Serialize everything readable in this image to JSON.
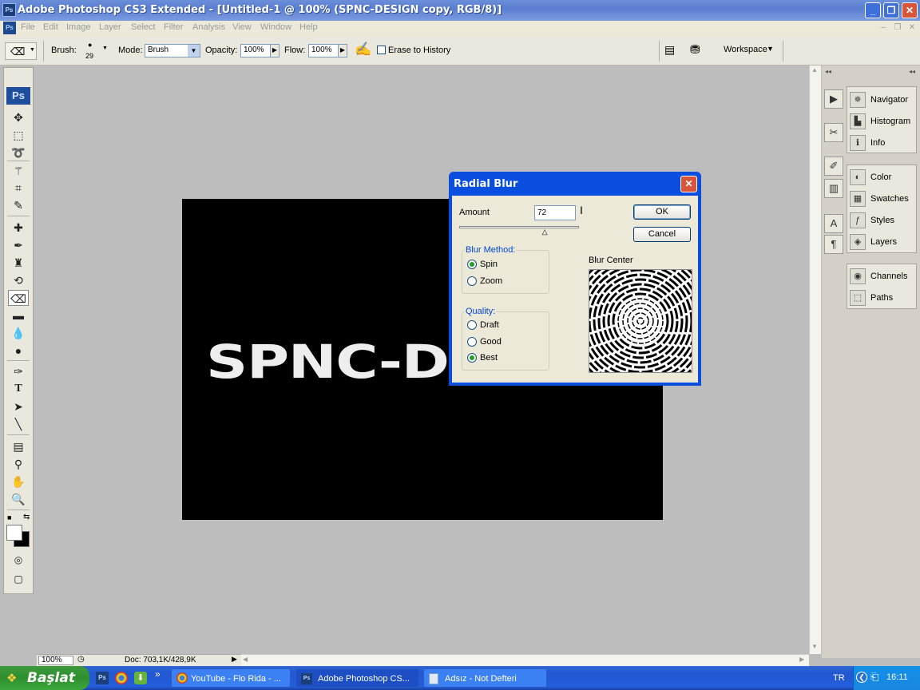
{
  "window": {
    "app_icon": "Ps",
    "title": "Adobe Photoshop CS3 Extended - [Untitled-1 @ 100% (SPNC-DESIGN copy, RGB/8)]",
    "controls": {
      "minimize": "_",
      "maximize": "❐",
      "close": "✕"
    }
  },
  "menubar": {
    "items": [
      "File",
      "Edit",
      "Image",
      "Layer",
      "Select",
      "Filter",
      "Analysis",
      "View",
      "Window",
      "Help"
    ],
    "mdi_controls": [
      "–",
      "❐",
      "✕"
    ]
  },
  "options": {
    "brush_label": "Brush:",
    "brush_size": "29",
    "mode_label": "Mode:",
    "mode_value": "Brush",
    "opacity_label": "Opacity:",
    "opacity_value": "100%",
    "flow_label": "Flow:",
    "flow_value": "100%",
    "erase_history_label": "Erase to History",
    "erase_history_checked": false,
    "workspace_label": "Workspace"
  },
  "tools": {
    "logo": "Ps",
    "items": [
      "move-icon",
      "marquee-icon",
      "lasso-icon",
      "magic-wand-icon",
      "crop-icon",
      "slice-icon",
      "healing-brush-icon",
      "brush-icon",
      "clone-stamp-icon",
      "history-brush-icon",
      "eraser-icon",
      "gradient-icon",
      "blur-icon",
      "dodge-icon",
      "pen-icon",
      "type-icon",
      "path-selection-icon",
      "line-icon",
      "notes-icon",
      "eyedropper-icon",
      "hand-icon",
      "zoom-icon"
    ],
    "active": "eraser-icon",
    "type_glyph": "T"
  },
  "canvas": {
    "text": "SPNC-D",
    "background": "#000000",
    "text_color": "#eeeeee"
  },
  "status": {
    "zoom": "100%",
    "doc": "Doc: 703,1K/428,9K"
  },
  "panels": {
    "group1": [
      "Navigator",
      "Histogram",
      "Info"
    ],
    "group2": [
      "Color",
      "Swatches",
      "Styles",
      "Layers"
    ],
    "group3": [
      "Channels",
      "Paths"
    ],
    "icons1": [
      "navigator-icon",
      "histogram-icon",
      "info-icon"
    ],
    "icons2": [
      "color-icon",
      "swatches-icon",
      "styles-icon",
      "layers-icon"
    ],
    "icons3": [
      "channels-icon",
      "paths-icon"
    ]
  },
  "dialog": {
    "title": "Radial Blur",
    "amount_label": "Amount",
    "amount_value": "72",
    "amount_range": [
      1,
      100
    ],
    "ok_label": "OK",
    "cancel_label": "Cancel",
    "blur_method_label": "Blur Method:",
    "method_options": [
      "Spin",
      "Zoom"
    ],
    "method_selected": "Spin",
    "quality_label": "Quality:",
    "quality_options": [
      "Draft",
      "Good",
      "Best"
    ],
    "quality_selected": "Best",
    "blur_center_label": "Blur Center"
  },
  "taskbar": {
    "start_label": "Başlat",
    "tasks": [
      {
        "label": "YouTube - Flo Rida - ...",
        "icon": "chrome-icon",
        "active": false
      },
      {
        "label": "Adobe Photoshop CS...",
        "icon": "photoshop-icon",
        "active": true
      },
      {
        "label": "Adsız - Not Defteri",
        "icon": "notepad-icon",
        "active": false
      }
    ],
    "quick_launch": [
      "Ps",
      "chrome-icon",
      "torrent-icon"
    ],
    "chevron": "»",
    "language": "TR",
    "clock": "16:11"
  },
  "colors": {
    "xp_blue": "#0a4ee0",
    "workspace": "#bdbdbd",
    "panel": "#eae7dc"
  }
}
